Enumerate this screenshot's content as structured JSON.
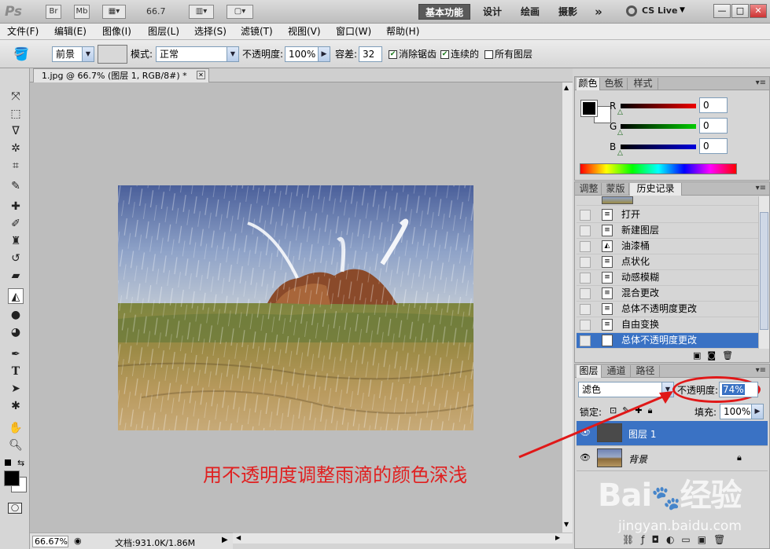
{
  "app": {
    "logo": "Ps",
    "bridge": "Br",
    "minibridge": "Mb",
    "zoom_display": "66.7",
    "workspaces": [
      "基本功能",
      "设计",
      "绘画",
      "摄影"
    ],
    "more": "»",
    "cs_live": "CS Live",
    "window_buttons": [
      "—",
      "□",
      "✕"
    ]
  },
  "menu": [
    "文件(F)",
    "编辑(E)",
    "图像(I)",
    "图层(L)",
    "选择(S)",
    "滤镜(T)",
    "视图(V)",
    "窗口(W)",
    "帮助(H)"
  ],
  "options": {
    "fill_source": "前景",
    "mode_label": "模式:",
    "mode_value": "正常",
    "opacity_label": "不透明度:",
    "opacity_value": "100%",
    "tolerance_label": "容差:",
    "tolerance_value": "32",
    "antialias_label": "消除锯齿",
    "antialias_checked": true,
    "contiguous_label": "连续的",
    "contiguous_checked": true,
    "all_layers_label": "所有图层",
    "all_layers_checked": false
  },
  "document": {
    "tab_title": "1.jpg @ 66.7% (图层 1, RGB/8#) *",
    "close": "✕",
    "zoom": "66.67%",
    "doc_info": "文档:931.0K/1.86M"
  },
  "color_panel": {
    "tabs": [
      "颜色",
      "色板",
      "样式"
    ],
    "channels": [
      {
        "name": "R",
        "value": "0",
        "color": "#cc0000"
      },
      {
        "name": "G",
        "value": "0",
        "color": "#00a000"
      },
      {
        "name": "B",
        "value": "0",
        "color": "#0000c0"
      }
    ]
  },
  "history_panel": {
    "tabs": [
      "调整",
      "蒙版",
      "历史记录"
    ],
    "items": [
      "打开",
      "新建图层",
      "油漆桶",
      "点状化",
      "动感模糊",
      "混合更改",
      "总体不透明度更改",
      "自由变换",
      "总体不透明度更改"
    ],
    "selected_index": 8
  },
  "layers_panel": {
    "tabs": [
      "图层",
      "通道",
      "路径"
    ],
    "blend_mode": "滤色",
    "opacity_label": "不透明度:",
    "opacity_value": "74%",
    "lock_label": "锁定:",
    "fill_label": "填充:",
    "fill_value": "100%",
    "layers": [
      {
        "name": "图层 1",
        "selected": true,
        "locked": false
      },
      {
        "name": "背景",
        "selected": false,
        "locked": true
      }
    ],
    "footer_icons": [
      "link-icon",
      "fx-icon",
      "mask-icon",
      "adjustment-icon",
      "group-icon",
      "new-layer-icon",
      "trash-icon"
    ]
  },
  "annotation": "用不透明度调整雨滴的颜色深浅",
  "watermark": {
    "brand": "Bai经验",
    "url": "jingyan.baidu.com"
  },
  "colors": {
    "accent": "#3a72c4",
    "annotation": "#e02020"
  }
}
